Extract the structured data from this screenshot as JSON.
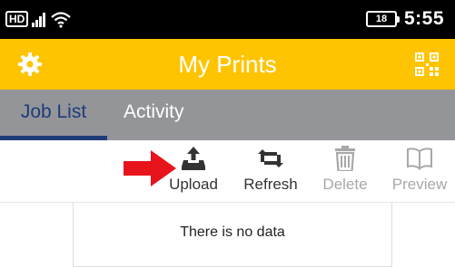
{
  "status_bar": {
    "network_badge": "HD",
    "battery_level": "18",
    "time": "5:55",
    "icons": [
      "hd-icon",
      "signal-icon",
      "wifi-icon",
      "battery-icon"
    ]
  },
  "app_bar": {
    "title": "My Prints",
    "background": "#FFC401",
    "left_icon": "gear-icon",
    "right_icon": "qr-code-icon"
  },
  "tabs": [
    {
      "label": "Job List",
      "active": true
    },
    {
      "label": "Activity",
      "active": false
    }
  ],
  "toolbar": {
    "actions": [
      {
        "label": "Upload",
        "icon": "upload-icon",
        "enabled": true
      },
      {
        "label": "Refresh",
        "icon": "refresh-icon",
        "enabled": true
      },
      {
        "label": "Delete",
        "icon": "trash-icon",
        "enabled": false
      },
      {
        "label": "Preview",
        "icon": "book-icon",
        "enabled": false
      }
    ],
    "annotation": {
      "icon": "red-arrow-icon",
      "color": "#E8141C",
      "points_to": "Upload"
    }
  },
  "list": {
    "empty_message": "There is no data"
  },
  "colors": {
    "accent": "#FFC401",
    "tab_bar": "#939598",
    "active_tab": "#1F3B7A",
    "disabled_text": "#A8A8A8"
  }
}
